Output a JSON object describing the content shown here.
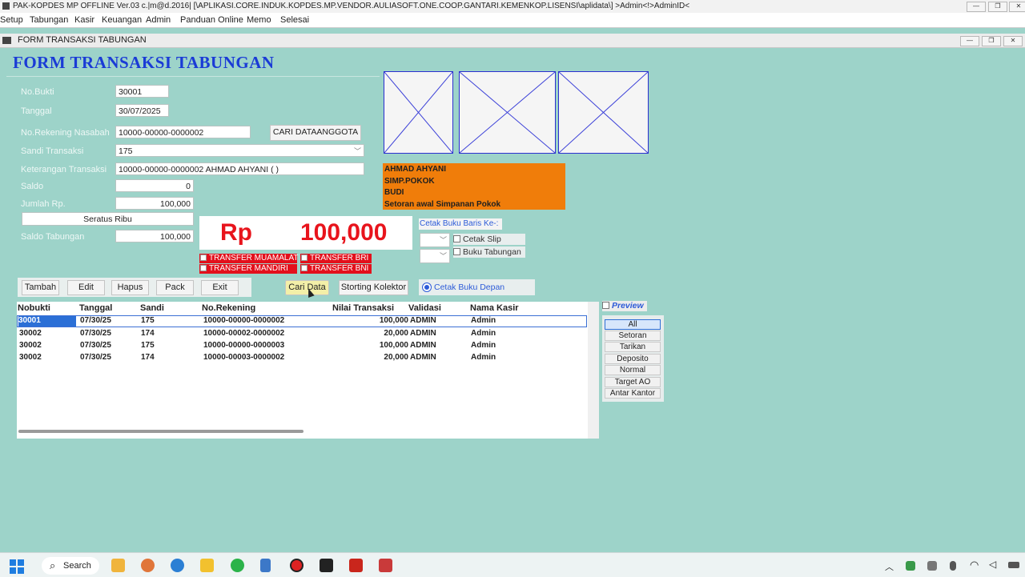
{
  "window": {
    "title": "PAK-KOPDES MP OFFLINE Ver.03 c.|m@d.2016| [\\APLIKASI.CORE.INDUK.KOPDES.MP.VENDOR.AULIASOFT.ONE.COOP.GANTARI.KEMENKOP.LISENSI\\aplidata\\] >Admin<!>AdminID<",
    "minimize": "—",
    "maximize": "❐",
    "close": "✕"
  },
  "menu": [
    "Setup",
    "Tabungan",
    "Kasir",
    "Keuangan",
    "Admin",
    "Panduan Online",
    "Memo",
    "Selesai"
  ],
  "child_window": {
    "title": "FORM TRANSAKSI TABUNGAN"
  },
  "form": {
    "heading": "FORM TRANSAKSI TABUNGAN",
    "labels": {
      "no_bukti": "No.Bukti",
      "tanggal": "Tanggal",
      "no_rekening": "No.Rekening Nasabah",
      "sandi": "Sandi Transaksi",
      "keterangan": "Keterangan Transaksi",
      "saldo": "Saldo",
      "jumlah": "Jumlah Rp.",
      "saldo_tabungan": "Saldo Tabungan"
    },
    "values": {
      "no_bukti": "30001",
      "tanggal": "30/07/2025",
      "no_rekening": "10000-00000-0000002",
      "sandi": "175",
      "keterangan": "10000-00000-0000002 AHMAD AHYANI ( )",
      "saldo": "0",
      "jumlah": "100,000",
      "terbilang": "Seratus Ribu",
      "saldo_tabungan": "100,000"
    },
    "cari_anggota_button": "CARI DATAANGGOTA"
  },
  "info_panel": {
    "lines": [
      "AHMAD AHYANI",
      "SIMP.POKOK",
      "BUDI",
      "Setoran awal Simpanan Pokok"
    ]
  },
  "amount_display": {
    "currency": "Rp",
    "amount": "100,000"
  },
  "transfer_options": {
    "muamalat": "TRANSFER MUAMALAT",
    "bri": "TRANSFER BRI",
    "mandiri": "TRANSFER MANDIRI",
    "bni": "TRANSFER BNI"
  },
  "print": {
    "baris_label": "Cetak Buku Baris Ke-:",
    "cetak_slip": "Cetak Slip",
    "buku_tabungan": "Buku Tabungan",
    "cetak_buku_depan": "Cetak Buku Depan"
  },
  "actions": {
    "tambah": "Tambah",
    "edit": "Edit",
    "hapus": "Hapus",
    "pack": "Pack",
    "exit": "Exit",
    "cari_data": "Cari Data",
    "storting": "Storting Kolektor"
  },
  "grid": {
    "columns": [
      "Nobukti",
      "Tanggal",
      "Sandi",
      "No.Rekening",
      "Nilai Transaksi",
      "Validasi",
      "Nama Kasir"
    ],
    "rows": [
      [
        "30001",
        "07/30/25",
        "175",
        "10000-00000-0000002",
        "100,000",
        "ADMIN",
        "Admin"
      ],
      [
        "30002",
        "07/30/25",
        "174",
        "10000-00002-0000002",
        "20,000",
        "ADMIN",
        "Admin"
      ],
      [
        "30002",
        "07/30/25",
        "175",
        "10000-00000-0000003",
        "100,000",
        "ADMIN",
        "Admin"
      ],
      [
        "30002",
        "07/30/25",
        "174",
        "10000-00003-0000002",
        "20,000",
        "ADMIN",
        "Admin"
      ]
    ]
  },
  "preview": {
    "label": "Preview"
  },
  "filters": [
    "All",
    "Setoran",
    "Tarikan",
    "Deposito",
    "Normal",
    "Target AO",
    "Antar Kantor"
  ],
  "taskbar": {
    "search": "Search"
  },
  "colors": {
    "background": "#9dd3c9",
    "heading": "#1a3bd6",
    "amount": "#e8141c",
    "info_panel": "#f07d0a",
    "transfer": "#e3101c"
  }
}
